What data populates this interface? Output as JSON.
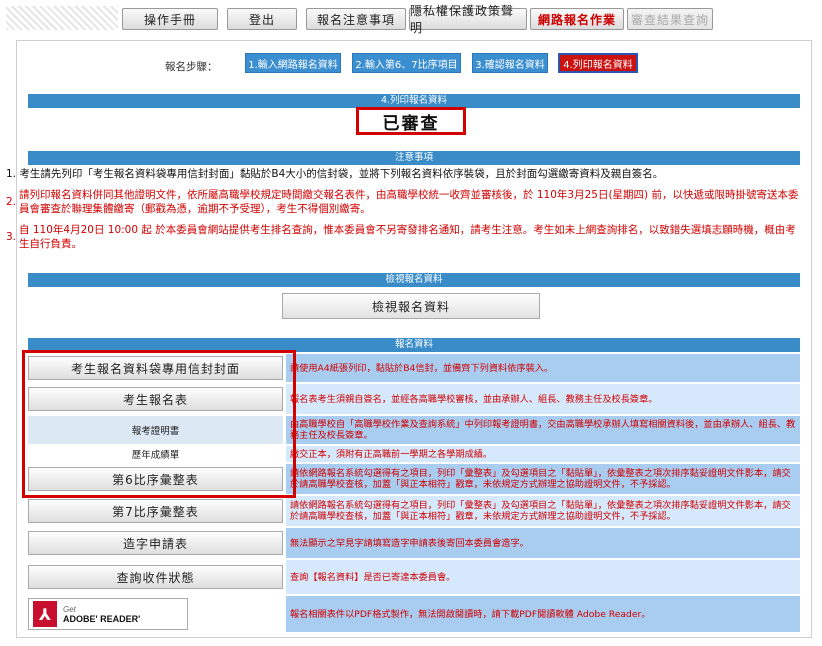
{
  "nav": {
    "manual": "操作手冊",
    "logout": "登出",
    "notes": "報名注意事項",
    "privacy": "隱私權保護政策聲明",
    "online": "網路報名作業",
    "result": "審查結果查詢"
  },
  "steps": {
    "label": "報名步驟：",
    "items": [
      "1.輸入網路報名資料",
      "2.輸入第6、7比序項目",
      "3.確認報名資料",
      "4.列印報名資料"
    ]
  },
  "print_section": {
    "header": "4.列印報名資料",
    "status": "已審查"
  },
  "notice": {
    "header": "注意事項",
    "items": [
      {
        "num": "1.",
        "text": "考生請先列印「考生報名資料袋專用信封封面」黏貼於B4大小的信封袋，並將下列報名資料依序裝袋，且於封面勾選繳寄資料及親自簽名。"
      },
      {
        "num": "2.",
        "text": "請列印報名資料併同其他證明文件，依所屬高職學校規定時間繳交報名表件，由高職學校統一收齊並審核後，於 110年3月25日(星期四) 前，以快遞或限時掛號寄送本委員會審查於聯理集體繳寄（郵戳為憑，逾期不予受理），考生不得個別繳寄。"
      },
      {
        "num": "3.",
        "text": "自 110年4月20日 10:00 起 於本委員會網站提供考生排名查詢，惟本委員會不另寄發排名通知，請考生注意。考生如未上網查詢排名，以致錯失選填志願時機，概由考生自行負責。"
      }
    ]
  },
  "view_section": {
    "header": "檢視報名資料",
    "button": "檢視報名資料"
  },
  "data_section": {
    "header": "報名資料",
    "rows": [
      {
        "label": "考生報名資料袋專用信封封面",
        "desc": "請使用A4紙張列印，黏貼於B4信封，並備齊下列資料依序裝入。"
      },
      {
        "label": "考生報名表",
        "desc": "報名表考生須親自簽名，並經各高職學校審核，並由承辦人、組長、教務主任及校長簽章。"
      },
      {
        "label": "報考證明書",
        "desc": "由高職學校自「高職學校作業及查詢系統」中列印報考證明書，交由高職學校承辦人填寫相關資料後，並由承辦人、組長、教務主任及校長簽章。"
      },
      {
        "label": "歷年成績單",
        "desc": "繳交正本，須附有正高職前一學期之各學期成績。"
      },
      {
        "label": "第6比序彙整表",
        "desc": "請依網路報名系統勾選得有之項目，列印「彙整表」及勾選項目之「黏貼單」，依彙整表之項次排序黏妥證明文件影本，請交於請高職學校查核，加蓋「與正本相符」戳章，未依規定方式辦理之協助證明文件，不予採認。"
      },
      {
        "label": "第7比序彙整表",
        "desc": "請依網路報名系統勾選得有之項目，列印「彙整表」及勾選項目之「黏貼單」，依彙整表之項次排序黏妥證明文件影本，請交於請高職學校查核，加蓋「與正本相符」戳章，未依規定方式辦理之協助證明文件，不予採認。"
      },
      {
        "label": "造字申請表",
        "desc": "無法顯示之罕見字請填寫造字申請表後寄回本委員會造字。"
      },
      {
        "label": "查詢收件狀態",
        "desc": "查詢【報名資料】是否已寄達本委員會。"
      }
    ],
    "adobe": {
      "get": "Get",
      "name": "ADOBE' READER'",
      "desc": "報名相關表件以PDF格式製作，無法開啟閱讀時，請下載PDF閱讀軟體 Adobe Reader。"
    }
  },
  "colors": {
    "header_blue": "#3a8cc8",
    "step_blue": "#3b8fd1",
    "step_red": "#cc1111",
    "highlight_red": "#d40000"
  }
}
